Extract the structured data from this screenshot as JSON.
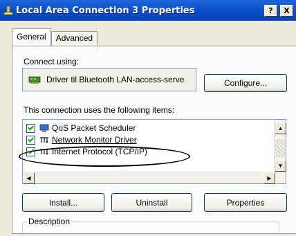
{
  "window": {
    "title": "Local Area Connection 3 Properties",
    "help_label": "?",
    "close_label": "X"
  },
  "tabs": [
    {
      "label": "General",
      "active": true
    },
    {
      "label": "Advanced",
      "active": false
    }
  ],
  "connect_using": {
    "label": "Connect using:",
    "adapter": "Driver til Bluetooth LAN-access-serve",
    "configure_button": "Configure..."
  },
  "items_section": {
    "label": "This connection uses the following items:",
    "items": [
      {
        "label": "QoS Packet Scheduler",
        "checked": true,
        "icon": "network-service-icon"
      },
      {
        "label": "Network Monitor Driver",
        "checked": true,
        "icon": "protocol-icon"
      },
      {
        "label": "Internet Protocol (TCP/IP)",
        "checked": true,
        "icon": "protocol-icon"
      }
    ]
  },
  "buttons": {
    "install": "Install...",
    "uninstall": "Uninstall",
    "properties": "Properties"
  },
  "description": {
    "label": "Description"
  }
}
